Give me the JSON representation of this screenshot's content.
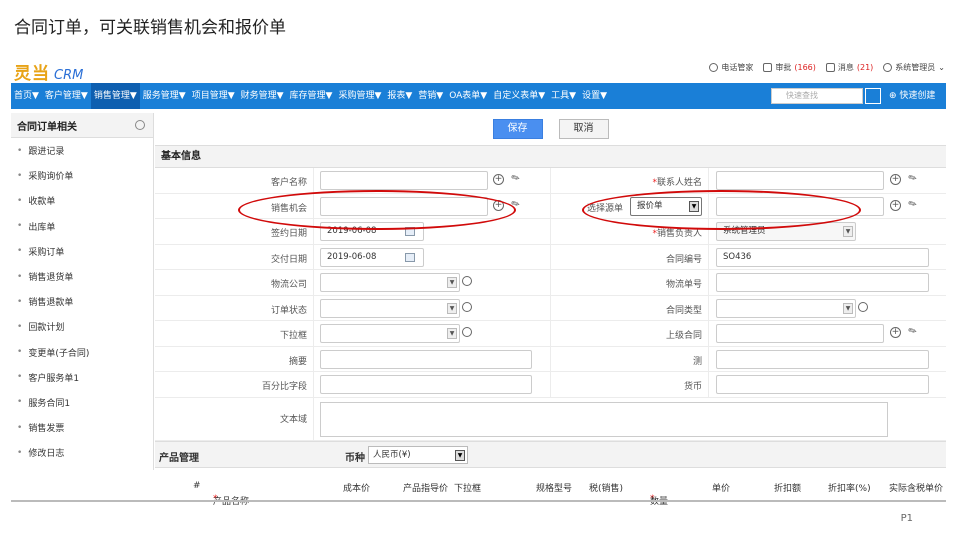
{
  "slide": {
    "title": "合同订单，可关联销售机会和报价单",
    "page": "P1"
  },
  "logo": {
    "cn": "灵当",
    "en": "CRM"
  },
  "topbar": {
    "phone": "电话管家",
    "approve": "审批",
    "approve_count": "(166)",
    "msg": "消息",
    "msg_count": "(21)",
    "user": "系统管理员"
  },
  "nav": {
    "items": [
      "首页▼",
      "客户管理▼",
      "销售管理▼",
      "服务管理▼",
      "项目管理▼",
      "财务管理▼",
      "库存管理▼",
      "采购管理▼",
      "报表▼",
      "营销▼",
      "OA表单▼",
      "自定义表单▼",
      "工具▼",
      "设置▼"
    ],
    "search_placeholder": "快速查找",
    "create": "快速创建"
  },
  "sidebar": {
    "title": "合同订单相关",
    "items": [
      "跟进记录",
      "采购询价单",
      "收款单",
      "出库单",
      "采购订单",
      "销售退货单",
      "销售退款单",
      "回款计划",
      "变更单(子合同)",
      "客户服务单1",
      "服务合同1",
      "销售发票",
      "修改日志"
    ]
  },
  "buttons": {
    "save": "保存",
    "cancel": "取消"
  },
  "section_basic": "基本信息",
  "form": {
    "customer": "客户名称",
    "contact": "联系人姓名",
    "opportunity": "销售机会",
    "source_label": "选择源单",
    "source_value": "报价单",
    "sign_date": "签约日期",
    "sign_date_value": "2019-06-08",
    "sales_owner": "销售负责人",
    "sales_owner_value": "系统管理员",
    "delivery_date": "交付日期",
    "delivery_date_value": "2019-06-08",
    "contract_no": "合同编号",
    "contract_no_value": "SO436",
    "logistics": "物流公司",
    "tracking_no": "物流单号",
    "order_status": "订单状态",
    "contract_type": "合同类型",
    "dropdown": "下拉框",
    "parent_contract": "上级合同",
    "summary": "摘要",
    "test": "测",
    "percent_field": "百分比字段",
    "currency": "货币",
    "text_field": "文本域"
  },
  "product": {
    "title": "产品管理",
    "currency_label": "币种",
    "currency_value": "人民币(¥)",
    "columns": [
      "#",
      "产品名称",
      "成本价",
      "产品指导价",
      "下拉框",
      "规格型号",
      "税(销售)",
      "数量",
      "单价",
      "折扣额",
      "折扣率(%)",
      "实际含税单价"
    ]
  }
}
